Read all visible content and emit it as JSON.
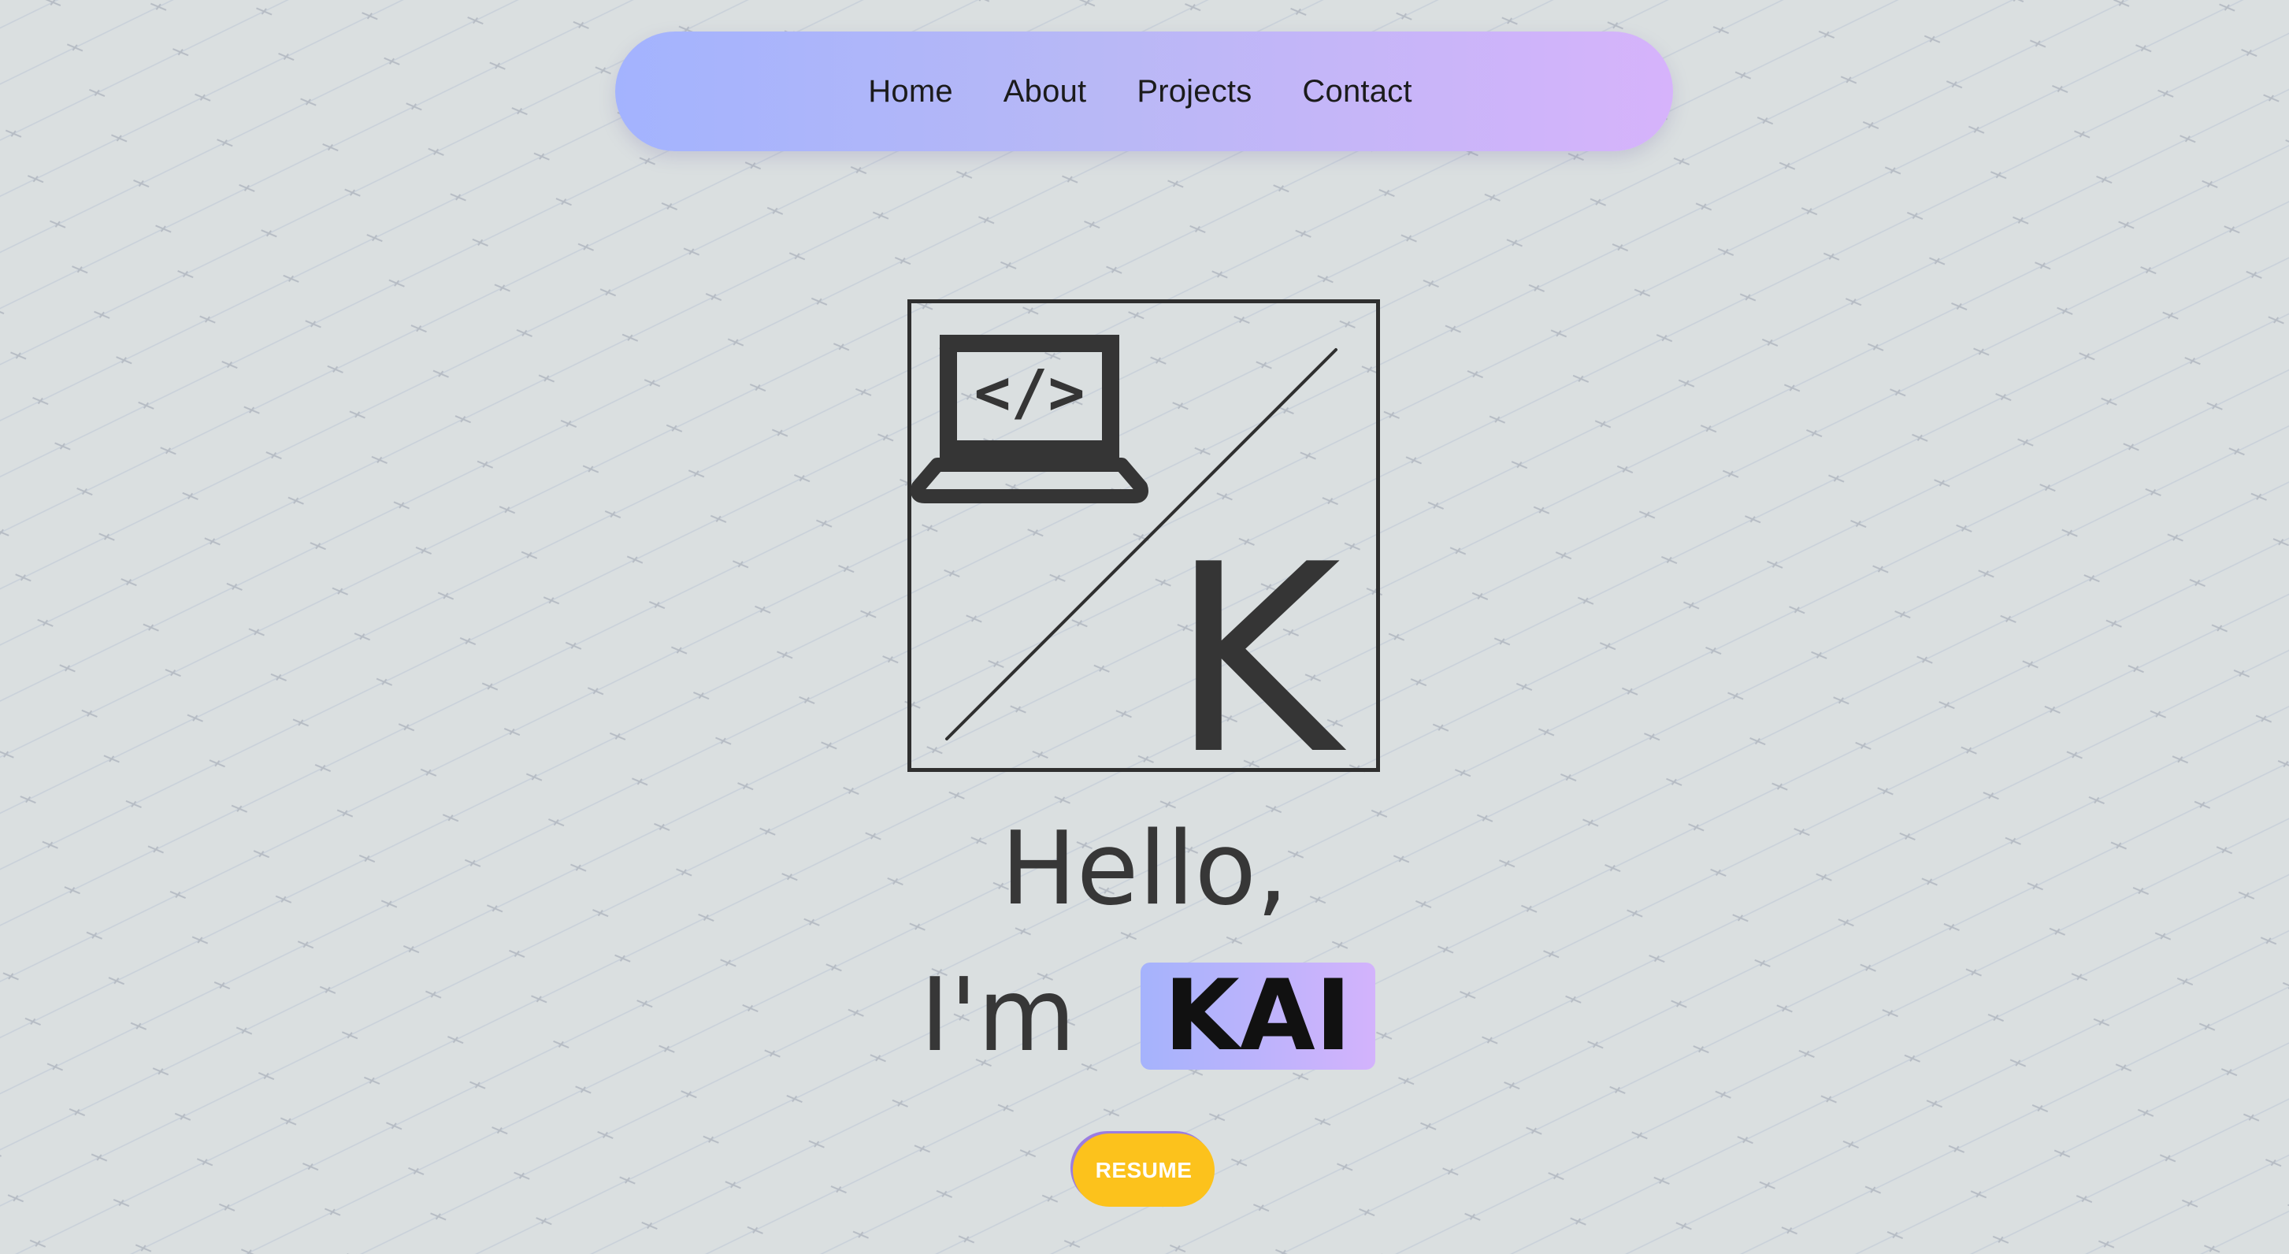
{
  "nav": {
    "links": [
      "Home",
      "About",
      "Projects",
      "Contact"
    ]
  },
  "logo": {
    "letter": "K",
    "laptop_code": "</>"
  },
  "hero": {
    "hello": "Hello,",
    "im": "I'm",
    "name": "KAI"
  },
  "resume_button": {
    "label": "RESUME"
  },
  "colors": {
    "background": "#dadfe0",
    "nav_gradient_start": "#a3b3fe",
    "nav_gradient_end": "#d6b3fb",
    "name_highlight_start": "#a5b3fc",
    "name_highlight_end": "#d3b3fc",
    "resume_button": "#fcc21c",
    "ink": "#373737"
  },
  "icons": [
    "laptop-code-icon"
  ]
}
